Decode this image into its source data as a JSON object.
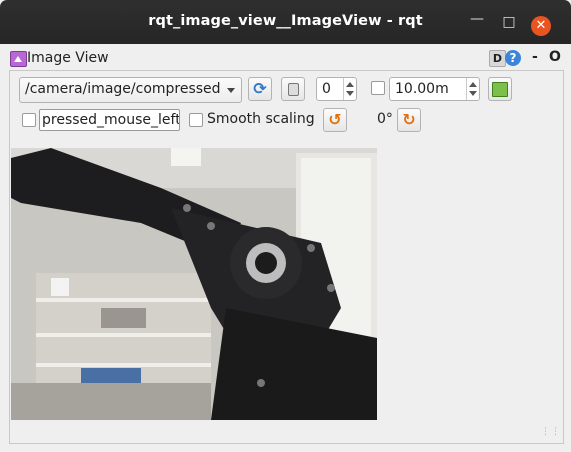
{
  "window": {
    "title": "rqt_image_view__ImageView - rqt"
  },
  "plugin": {
    "title": "Image View",
    "d_label": "D",
    "help_label": "?",
    "min_label": "-",
    "close_label": "O"
  },
  "toolbar": {
    "topic": "/camera/image/compressed",
    "num_value": "0",
    "range_value": "10.00m",
    "range_checked": false
  },
  "row2": {
    "mouse_checked": false,
    "mouse_topic": "pressed_mouse_left",
    "smooth_label": "Smooth scaling",
    "smooth_checked": false,
    "rotation": "0°"
  },
  "icons": {
    "refresh": "refresh-icon",
    "pause": "pause-icon",
    "save": "save-icon",
    "rotate_left": "rotate-left-icon",
    "rotate_right": "rotate-right-icon"
  }
}
